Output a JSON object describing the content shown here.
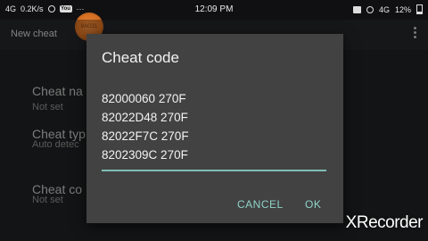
{
  "status_bar": {
    "network_left": "4G",
    "speed": "0.2K/s",
    "yt_label": "You",
    "more": "···",
    "time": "12:09 PM",
    "network_right": "4G",
    "battery": "12%"
  },
  "app_bar": {
    "title": "New cheat",
    "touch_indicator": "8AG31"
  },
  "list": {
    "items": [
      {
        "title": "Cheat na",
        "sub": "Not set"
      },
      {
        "title": "Cheat typ",
        "sub": "Auto detec"
      },
      {
        "title": "Cheat co",
        "sub": "Not set"
      }
    ]
  },
  "dialog": {
    "title": "Cheat code",
    "code_value": "82000060 270F\n82022D48 270F\n82022F7C 270F\n8202309C 270F",
    "cancel_label": "CANCEL",
    "ok_label": "OK"
  },
  "watermark": "XRecorder",
  "colors": {
    "accent": "#8fd3c6",
    "underline": "#7fbfb4",
    "dialog_bg": "#424242",
    "touch_dot": "#e88a3c"
  }
}
